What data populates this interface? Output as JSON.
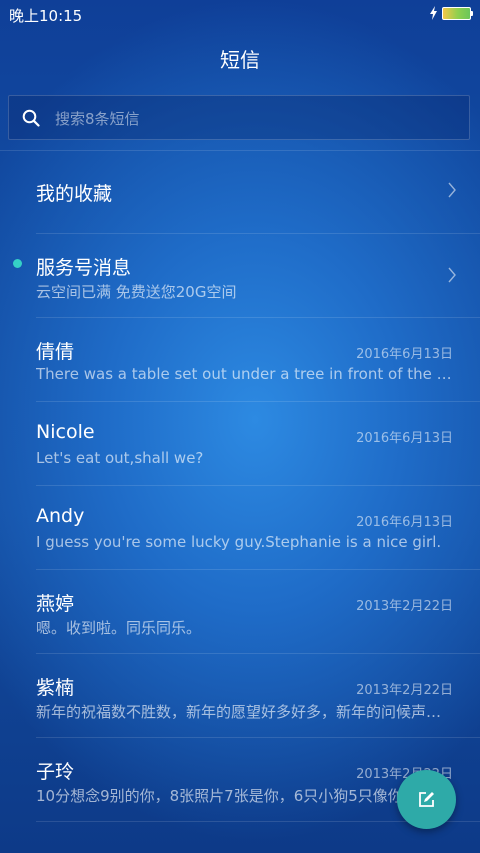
{
  "status_bar": {
    "time": "晚上10:15"
  },
  "header": {
    "title": "短信"
  },
  "search": {
    "placeholder": "搜索8条短信"
  },
  "favorites": {
    "label": "我的收藏"
  },
  "service": {
    "label": "服务号消息",
    "preview": "云空间已满 免费送您20G空间"
  },
  "conversations": [
    {
      "name": "倩倩",
      "date": "2016年6月13日",
      "preview": "There was a table set out under a tree in front of the house"
    },
    {
      "name": "Nicole",
      "date": "2016年6月13日",
      "preview": "Let's eat out,shall we?"
    },
    {
      "name": "Andy",
      "date": "2016年6月13日",
      "preview": "I guess you're some lucky guy.Stephanie is a nice girl."
    },
    {
      "name": "燕婷",
      "date": "2013年2月22日",
      "preview": "嗯。收到啦。同乐同乐。"
    },
    {
      "name": "紫楠",
      "date": "2013年2月22日",
      "preview": "新年的祝福数不胜数，新年的愿望好多好多，新年的问候声声不断"
    },
    {
      "name": "子玲",
      "date": "2013年2月22日",
      "preview": "10分想念9别的你，8张照片7张是你，6只小狗5只像你"
    }
  ],
  "colors": {
    "accent": "#2eaaa8",
    "unread_dot": "#35d0c6",
    "background": "#1656b2"
  },
  "icons": {
    "search": "search-icon",
    "chevron": "chevron-right-icon",
    "compose": "compose-icon",
    "charging": "bolt-icon",
    "battery": "battery-icon"
  }
}
